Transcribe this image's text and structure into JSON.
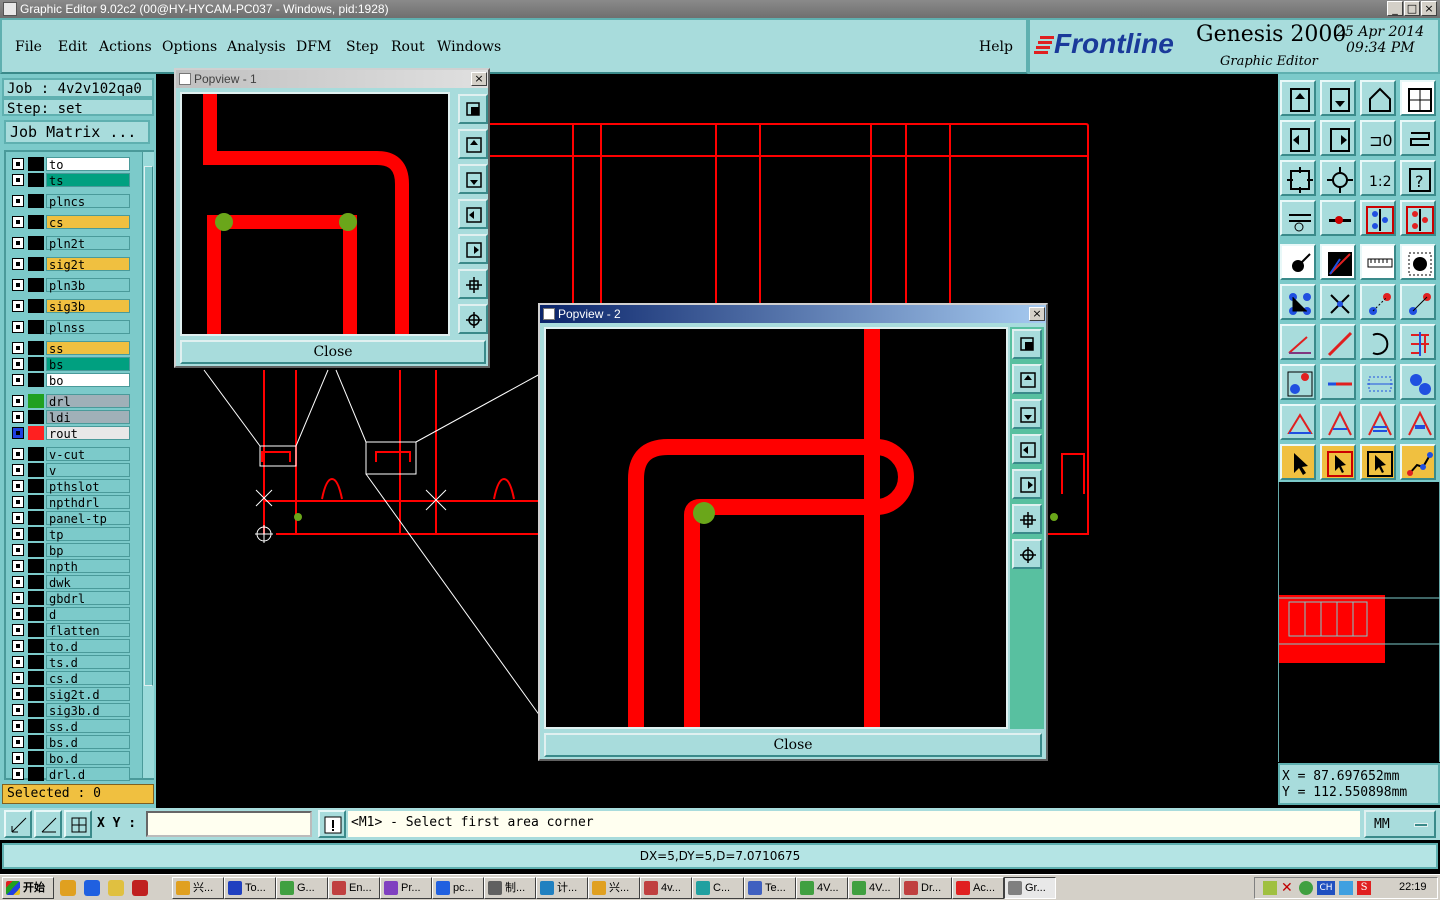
{
  "window": {
    "title": "Graphic Editor 9.02c2 (00@HY-HYCAM-PC037 - Windows, pid:1928)",
    "minimize": "_",
    "restore": "□",
    "close": "×"
  },
  "menu": {
    "items": [
      "File",
      "Edit",
      "Actions",
      "Options",
      "Analysis",
      "DFM",
      "Step",
      "Rout",
      "Windows"
    ],
    "help": "Help"
  },
  "brand": {
    "company": "Frontline",
    "product": "Genesis 2000",
    "subtitle": "Graphic Editor",
    "date": "25 Apr 2014",
    "time": "09:34 PM"
  },
  "job": {
    "job_label": "Job : 4v2v102qa0",
    "step_label": "Step: set",
    "matrix_button": "Job Matrix ..."
  },
  "layers": [
    {
      "name": "to",
      "color": "#ffffff"
    },
    {
      "name": "ts",
      "color": "#00a080"
    },
    {
      "name": "plncs",
      "color": "#7ccaca"
    },
    {
      "name": "cs",
      "color": "#f0c040"
    },
    {
      "name": "pln2t",
      "color": "#7ccaca"
    },
    {
      "name": "sig2t",
      "color": "#f0c040"
    },
    {
      "name": "pln3b",
      "color": "#7ccaca"
    },
    {
      "name": "sig3b",
      "color": "#f0c040"
    },
    {
      "name": "plnss",
      "color": "#7ccaca"
    },
    {
      "name": "ss",
      "color": "#f0c040"
    },
    {
      "name": "bs",
      "color": "#00a080"
    },
    {
      "name": "bo",
      "color": "#ffffff"
    },
    {
      "name": "drl",
      "color": "#a0b0b8"
    },
    {
      "name": "ldi",
      "color": "#a0b0b8"
    },
    {
      "name": "rout",
      "color": "#e8e8e8"
    },
    {
      "name": "v-cut",
      "color": "#7ccaca"
    },
    {
      "name": "v",
      "color": "#7ccaca"
    },
    {
      "name": "pthslot",
      "color": "#7ccaca"
    },
    {
      "name": "npthdrl",
      "color": "#7ccaca"
    },
    {
      "name": "panel-tp",
      "color": "#7ccaca"
    },
    {
      "name": "tp",
      "color": "#7ccaca"
    },
    {
      "name": "bp",
      "color": "#7ccaca"
    },
    {
      "name": "npth",
      "color": "#7ccaca"
    },
    {
      "name": "dwk",
      "color": "#7ccaca"
    },
    {
      "name": "gbdrl",
      "color": "#7ccaca"
    },
    {
      "name": "d",
      "color": "#7ccaca"
    },
    {
      "name": "flatten",
      "color": "#7ccaca"
    },
    {
      "name": "to.d",
      "color": "#7ccaca"
    },
    {
      "name": "ts.d",
      "color": "#7ccaca"
    },
    {
      "name": "cs.d",
      "color": "#7ccaca"
    },
    {
      "name": "sig2t.d",
      "color": "#7ccaca"
    },
    {
      "name": "sig3b.d",
      "color": "#7ccaca"
    },
    {
      "name": "ss.d",
      "color": "#7ccaca"
    },
    {
      "name": "bs.d",
      "color": "#7ccaca"
    },
    {
      "name": "bo.d",
      "color": "#7ccaca"
    },
    {
      "name": "drl.d",
      "color": "#7ccaca"
    }
  ],
  "selected": "Selected : 0",
  "popview1": {
    "title": "Popview - 1",
    "close_label": "Close"
  },
  "popview2": {
    "title": "Popview - 2",
    "close_label": "Close"
  },
  "coords": {
    "x": "X  =  87.697652mm",
    "y": "Y  = 112.550898mm"
  },
  "status": {
    "xy_label": "X Y :",
    "xy_value": "",
    "prompt": "<M1> - Select first area corner",
    "units": "MM"
  },
  "info": "DX=5,DY=5,D=7.0710675",
  "taskbar": {
    "start": "开始",
    "tasks": [
      "兴...",
      "To...",
      "G...",
      "En...",
      "Pr...",
      "pc...",
      "制...",
      "计...",
      "兴...",
      "4v...",
      "C...",
      "Te...",
      "4V...",
      "4V...",
      "Dr...",
      "Ac...",
      "Gr..."
    ],
    "clock": "22:19"
  },
  "colors": {
    "trace": "#ff0000",
    "pad": "#6aa61a",
    "panel": "#a8dcdc",
    "panel_dark": "#7ccaca"
  }
}
